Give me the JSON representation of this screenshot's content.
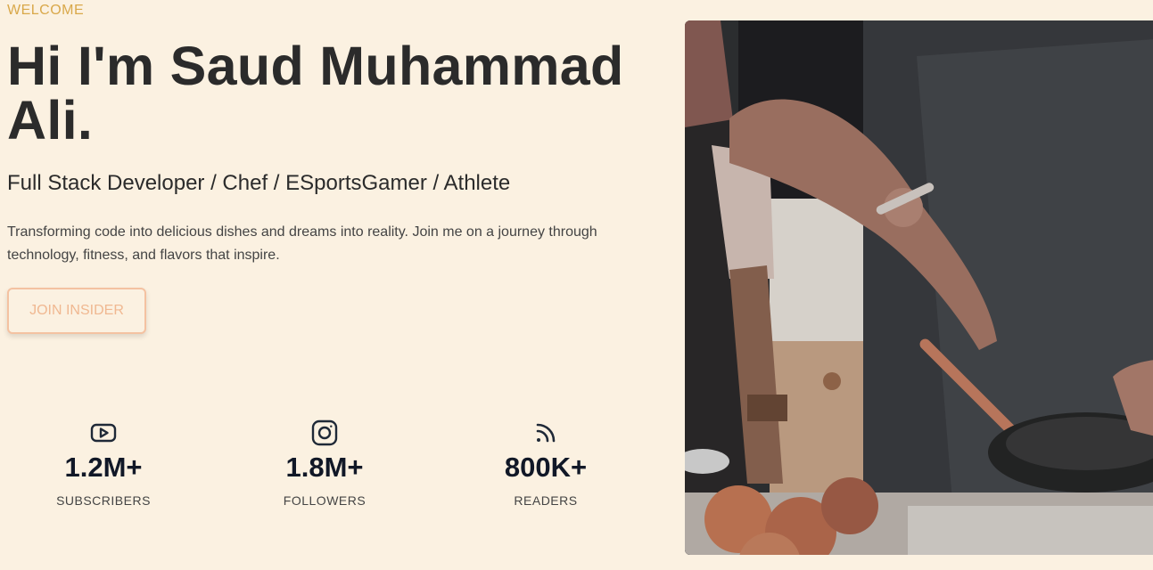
{
  "hero": {
    "eyebrow": "WELCOME",
    "title": "Hi I'm Saud Muhammad Ali.",
    "subtitle": "Full Stack Developer / Chef / ESportsGamer / Athlete",
    "description": "Transforming code into delicious dishes and dreams into reality. Join me on a journey through technology, fitness, and flavors that inspire.",
    "cta_label": "JOIN INSIDER"
  },
  "stats": [
    {
      "icon": "youtube-icon",
      "value": "1.2M+",
      "label": "SUBSCRIBERS"
    },
    {
      "icon": "instagram-icon",
      "value": "1.8M+",
      "label": "FOLLOWERS"
    },
    {
      "icon": "rss-icon",
      "value": "800K+",
      "label": "READERS"
    }
  ],
  "colors": {
    "background": "#fbf1e1",
    "eyebrow": "#d9a84a",
    "heading": "#2b2b2b",
    "cta_border": "#f4c2a1",
    "cta_text": "#f0b891"
  }
}
